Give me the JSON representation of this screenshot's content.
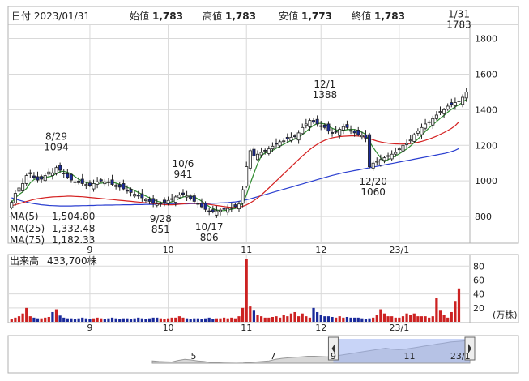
{
  "colors": {
    "up": "#ffffff",
    "down": "#1a2a9a",
    "ma5": "#2e8b2e",
    "ma25": "#d42020",
    "ma75": "#2b3fd0",
    "volume": "#cc2222",
    "label_red": "#cc1111",
    "label_green": "#1a7a1a",
    "grid": "#d9d9d9"
  },
  "header": {
    "date_label": "日付 2023/01/31",
    "open_label": "始値",
    "open_value": "1,783",
    "high_label": "高値",
    "high_value": "1,783",
    "low_label": "安値",
    "low_value": "1,773",
    "close_label": "終値",
    "close_value": "1,783"
  },
  "legend": {
    "ma5": "MA(5)",
    "ma5_value": "1,504.80",
    "ma25": "MA(25)",
    "ma25_value": "1,332.48",
    "ma75": "MA(75)",
    "ma75_value": "1,182.33"
  },
  "volume_header": {
    "label": "出来高",
    "value": "433,700株"
  },
  "unit_label": "(万株)",
  "chart_data": {
    "type": "candlestick",
    "y_axis": {
      "ticks": [
        800,
        1000,
        1200,
        1400,
        1600,
        1800
      ],
      "ylim": [
        650,
        1880
      ]
    },
    "x_labels": [
      {
        "label": "9",
        "index": 21
      },
      {
        "label": "10",
        "index": 42
      },
      {
        "label": "11",
        "index": 63
      },
      {
        "label": "12",
        "index": 83
      },
      {
        "label": "23/1",
        "index": 104
      }
    ],
    "annotations": [
      {
        "date": "8/29",
        "value": "1094",
        "index": 12,
        "price": 1094,
        "side": "above"
      },
      {
        "date": "9/28",
        "value": "851",
        "index": 40,
        "price": 851,
        "side": "below"
      },
      {
        "date": "10/6",
        "value": "941",
        "index": 46,
        "price": 941,
        "side": "above"
      },
      {
        "date": "10/17",
        "value": "806",
        "index": 53,
        "price": 806,
        "side": "below"
      },
      {
        "date": "12/1",
        "value": "1388",
        "index": 84,
        "price": 1388,
        "side": "above"
      },
      {
        "date": "12/20",
        "value": "1060",
        "index": 97,
        "price": 1060,
        "side": "below"
      },
      {
        "date": "1/31",
        "value": "1783",
        "index": 120,
        "price": 1783,
        "side": "above"
      }
    ],
    "closes": [
      880,
      930,
      960,
      985,
      1030,
      1040,
      1020,
      1005,
      1010,
      1030,
      1050,
      1045,
      1075,
      1060,
      1040,
      1020,
      1005,
      995,
      990,
      985,
      980,
      975,
      985,
      995,
      1000,
      995,
      990,
      980,
      975,
      965,
      955,
      945,
      935,
      925,
      915,
      905,
      895,
      885,
      875,
      870,
      872,
      880,
      890,
      900,
      910,
      920,
      925,
      915,
      900,
      885,
      870,
      855,
      840,
      830,
      828,
      832,
      836,
      840,
      845,
      850,
      855,
      870,
      950,
      1080,
      1170,
      1140,
      1150,
      1160,
      1170,
      1180,
      1195,
      1210,
      1220,
      1225,
      1235,
      1245,
      1250,
      1270,
      1300,
      1320,
      1340,
      1330,
      1320,
      1310,
      1300,
      1280,
      1270,
      1275,
      1290,
      1305,
      1300,
      1280,
      1270,
      1260,
      1255,
      1240,
      1080,
      1100,
      1110,
      1120,
      1130,
      1140,
      1150,
      1160,
      1180,
      1200,
      1210,
      1230,
      1260,
      1280,
      1300,
      1320,
      1330,
      1350,
      1370,
      1390,
      1400,
      1420,
      1430,
      1440,
      1450,
      1470,
      1500
    ],
    "ma5_range": [
      1500,
      1504.8
    ],
    "ma25": [
      860,
      866,
      872,
      878,
      884,
      890,
      896,
      900,
      903,
      906,
      908,
      910,
      911,
      912,
      913,
      914,
      914,
      913,
      912,
      911,
      909,
      907,
      905,
      903,
      901,
      899,
      897,
      895,
      893,
      891,
      889,
      887,
      885,
      883,
      881,
      879,
      877,
      875,
      873,
      871,
      869,
      867,
      866,
      866,
      867,
      869,
      871,
      873,
      874,
      874,
      873,
      872,
      870,
      868,
      865,
      862,
      859,
      856,
      853,
      851,
      850,
      852,
      857,
      865,
      876,
      889,
      904,
      921,
      940,
      960,
      980,
      1000,
      1020,
      1040,
      1060,
      1080,
      1100,
      1120,
      1140,
      1158,
      1176,
      1192,
      1206,
      1218,
      1228,
      1236,
      1242,
      1246,
      1249,
      1251,
      1252,
      1253,
      1253,
      1252,
      1250,
      1245,
      1238,
      1231,
      1224,
      1219,
      1215,
      1212,
      1210,
      1208,
      1207,
      1207,
      1208,
      1210,
      1213,
      1217,
      1222,
      1228,
      1235,
      1243,
      1252,
      1262,
      1272,
      1283,
      1295,
      1310,
      1332
    ],
    "ma75": [
      905,
      898,
      892,
      886,
      881,
      876,
      872,
      869,
      866,
      864,
      862,
      861,
      860,
      859,
      859,
      859,
      859,
      860,
      860,
      861,
      861,
      862,
      862,
      863,
      863,
      864,
      864,
      864,
      865,
      865,
      866,
      866,
      866,
      867,
      867,
      867,
      868,
      868,
      868,
      869,
      869,
      869,
      870,
      870,
      870,
      871,
      871,
      871,
      872,
      872,
      872,
      873,
      873,
      874,
      874,
      875,
      876,
      877,
      878,
      880,
      882,
      885,
      889,
      894,
      899,
      905,
      911,
      917,
      923,
      929,
      935,
      941,
      947,
      953,
      959,
      965,
      971,
      977,
      983,
      989,
      995,
      1001,
      1007,
      1013,
      1019,
      1025,
      1031,
      1036,
      1041,
      1046,
      1050,
      1054,
      1058,
      1062,
      1066,
      1070,
      1074,
      1078,
      1082,
      1086,
      1090,
      1094,
      1098,
      1102,
      1106,
      1110,
      1114,
      1118,
      1122,
      1126,
      1130,
      1134,
      1138,
      1142,
      1146,
      1150,
      1154,
      1159,
      1165,
      1172,
      1182
    ],
    "volume_axis": {
      "ticks": [
        20,
        40,
        60,
        80
      ],
      "ylim": [
        0,
        92
      ]
    },
    "volume": [
      4,
      6,
      8,
      12,
      20,
      8,
      6,
      5,
      5,
      6,
      7,
      14,
      18,
      9,
      6,
      5,
      5,
      4,
      5,
      6,
      5,
      4,
      5,
      6,
      5,
      4,
      5,
      6,
      5,
      4,
      5,
      5,
      4,
      5,
      6,
      5,
      4,
      5,
      6,
      6,
      5,
      4,
      5,
      6,
      6,
      8,
      6,
      5,
      4,
      5,
      5,
      4,
      5,
      6,
      4,
      5,
      5,
      6,
      5,
      6,
      5,
      8,
      20,
      90,
      22,
      16,
      10,
      8,
      6,
      6,
      7,
      8,
      6,
      10,
      8,
      12,
      14,
      8,
      12,
      8,
      6,
      20,
      14,
      10,
      8,
      8,
      7,
      6,
      8,
      6,
      7,
      6,
      6,
      6,
      5,
      4,
      5,
      6,
      10,
      18,
      12,
      8,
      8,
      6,
      6,
      8,
      12,
      10,
      12,
      8,
      8,
      8,
      6,
      8,
      34,
      16,
      10,
      6,
      14,
      30,
      48
    ],
    "navigator": {
      "labels": [
        {
          "label": "5",
          "pos": 0.13
        },
        {
          "label": "7",
          "pos": 0.38
        },
        {
          "label": "9",
          "pos": 0.57
        },
        {
          "label": "11",
          "pos": 0.81
        },
        {
          "label": "23/1",
          "pos": 0.97
        }
      ],
      "series": [
        870,
        860,
        855,
        850,
        880,
        900,
        890,
        870,
        860,
        840,
        835,
        830,
        828,
        826,
        830,
        840,
        850,
        860,
        870,
        900,
        920,
        930,
        940,
        950,
        960,
        960,
        955,
        950,
        960,
        980,
        1000,
        1020,
        1040,
        1060,
        1080,
        1100,
        1120,
        1100,
        1090,
        1100,
        1120,
        1140,
        1160,
        1180,
        1200,
        1220,
        1240,
        1250,
        1260,
        1270
      ],
      "window_start": 0.57,
      "window_end": 1.0
    }
  }
}
